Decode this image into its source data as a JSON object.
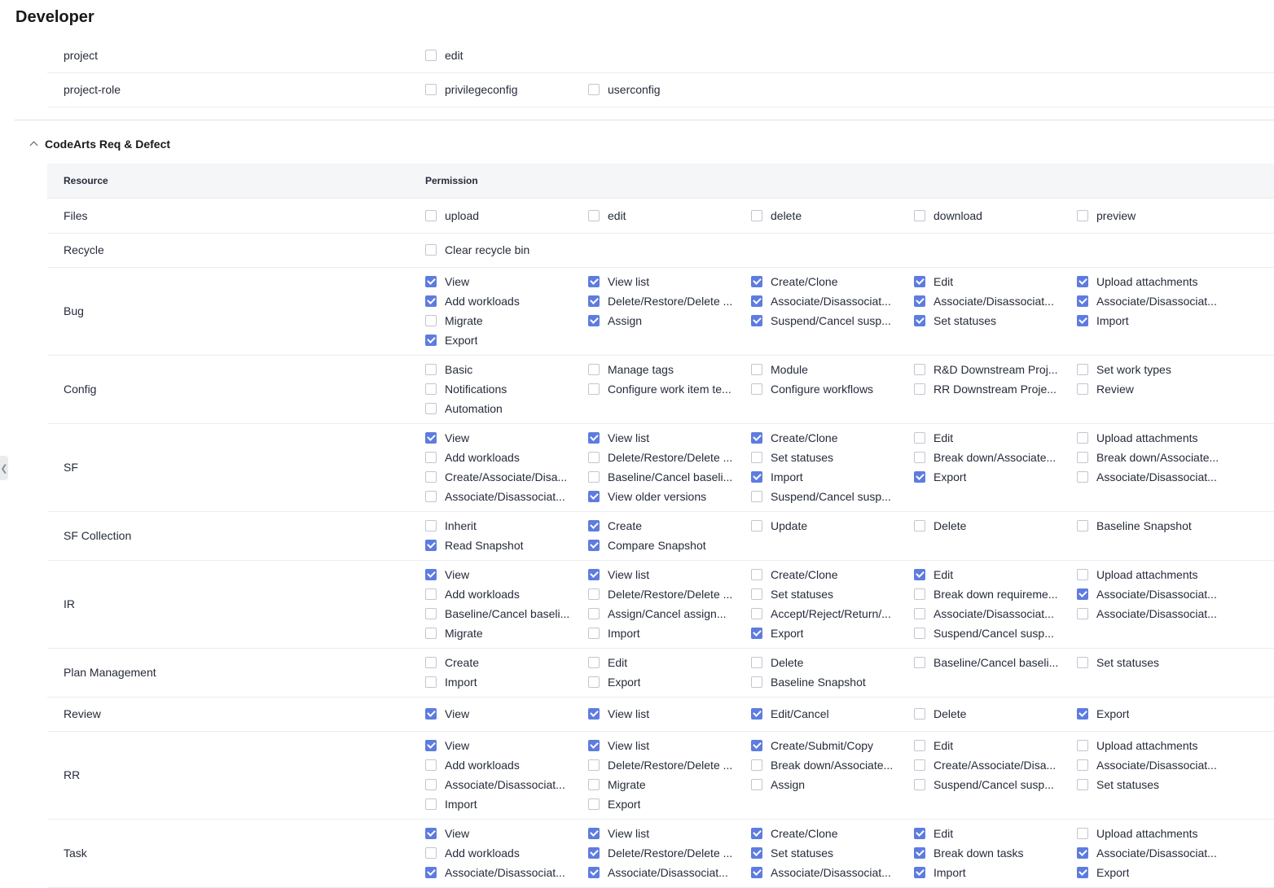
{
  "page": {
    "title": "Developer"
  },
  "section": {
    "title": "CodeArts Req & Defect"
  },
  "table": {
    "col_resource": "Resource",
    "col_permission": "Permission"
  },
  "top_rows": [
    {
      "name": "project",
      "perms": [
        {
          "label": "edit",
          "checked": false
        }
      ]
    },
    {
      "name": "project-role",
      "perms": [
        {
          "label": "privilegeconfig",
          "checked": false
        },
        {
          "label": "userconfig",
          "checked": false
        }
      ]
    }
  ],
  "rows": [
    {
      "name": "Files",
      "perms": [
        {
          "label": "upload",
          "checked": false
        },
        {
          "label": "edit",
          "checked": false
        },
        {
          "label": "delete",
          "checked": false
        },
        {
          "label": "download",
          "checked": false
        },
        {
          "label": "preview",
          "checked": false
        }
      ]
    },
    {
      "name": "Recycle",
      "perms": [
        {
          "label": "Clear recycle bin",
          "checked": false
        }
      ]
    },
    {
      "name": "Bug",
      "perms": [
        {
          "label": "View",
          "checked": true
        },
        {
          "label": "View list",
          "checked": true
        },
        {
          "label": "Create/Clone",
          "checked": true
        },
        {
          "label": "Edit",
          "checked": true
        },
        {
          "label": "Upload attachments",
          "checked": true
        },
        {
          "label": "Add workloads",
          "checked": true
        },
        {
          "label": "Delete/Restore/Delete ...",
          "checked": true
        },
        {
          "label": "Associate/Disassociat...",
          "checked": true
        },
        {
          "label": "Associate/Disassociat...",
          "checked": true
        },
        {
          "label": "Associate/Disassociat...",
          "checked": true
        },
        {
          "label": "Migrate",
          "checked": false
        },
        {
          "label": "Assign",
          "checked": true
        },
        {
          "label": "Suspend/Cancel susp...",
          "checked": true
        },
        {
          "label": "Set statuses",
          "checked": true
        },
        {
          "label": "Import",
          "checked": true
        },
        {
          "label": "Export",
          "checked": true
        }
      ]
    },
    {
      "name": "Config",
      "perms": [
        {
          "label": "Basic",
          "checked": false
        },
        {
          "label": "Manage tags",
          "checked": false
        },
        {
          "label": "Module",
          "checked": false
        },
        {
          "label": "R&D Downstream Proj...",
          "checked": false
        },
        {
          "label": "Set work types",
          "checked": false
        },
        {
          "label": "Notifications",
          "checked": false
        },
        {
          "label": "Configure work item te...",
          "checked": false
        },
        {
          "label": "Configure workflows",
          "checked": false
        },
        {
          "label": "RR Downstream Proje...",
          "checked": false
        },
        {
          "label": "Review",
          "checked": false
        },
        {
          "label": "Automation",
          "checked": false
        }
      ]
    },
    {
      "name": "SF",
      "perms": [
        {
          "label": "View",
          "checked": true
        },
        {
          "label": "View list",
          "checked": true
        },
        {
          "label": "Create/Clone",
          "checked": true
        },
        {
          "label": "Edit",
          "checked": false
        },
        {
          "label": "Upload attachments",
          "checked": false
        },
        {
          "label": "Add workloads",
          "checked": false
        },
        {
          "label": "Delete/Restore/Delete ...",
          "checked": false
        },
        {
          "label": "Set statuses",
          "checked": false
        },
        {
          "label": "Break down/Associate...",
          "checked": false
        },
        {
          "label": "Break down/Associate...",
          "checked": false
        },
        {
          "label": "Create/Associate/Disa...",
          "checked": false
        },
        {
          "label": "Baseline/Cancel baseli...",
          "checked": false
        },
        {
          "label": "Import",
          "checked": true
        },
        {
          "label": "Export",
          "checked": true
        },
        {
          "label": "Associate/Disassociat...",
          "checked": false
        },
        {
          "label": "Associate/Disassociat...",
          "checked": false
        },
        {
          "label": "View older versions",
          "checked": true
        },
        {
          "label": "Suspend/Cancel susp...",
          "checked": false
        }
      ]
    },
    {
      "name": "SF Collection",
      "perms": [
        {
          "label": "Inherit",
          "checked": false
        },
        {
          "label": "Create",
          "checked": true
        },
        {
          "label": "Update",
          "checked": false
        },
        {
          "label": "Delete",
          "checked": false
        },
        {
          "label": "Baseline Snapshot",
          "checked": false
        },
        {
          "label": "Read Snapshot",
          "checked": true
        },
        {
          "label": "Compare Snapshot",
          "checked": true
        }
      ]
    },
    {
      "name": "IR",
      "perms": [
        {
          "label": "View",
          "checked": true
        },
        {
          "label": "View list",
          "checked": true
        },
        {
          "label": "Create/Clone",
          "checked": false
        },
        {
          "label": "Edit",
          "checked": true
        },
        {
          "label": "Upload attachments",
          "checked": false
        },
        {
          "label": "Add workloads",
          "checked": false
        },
        {
          "label": "Delete/Restore/Delete ...",
          "checked": false
        },
        {
          "label": "Set statuses",
          "checked": false
        },
        {
          "label": "Break down requireme...",
          "checked": false
        },
        {
          "label": "Associate/Disassociat...",
          "checked": true
        },
        {
          "label": "Baseline/Cancel baseli...",
          "checked": false
        },
        {
          "label": "Assign/Cancel assign...",
          "checked": false
        },
        {
          "label": "Accept/Reject/Return/...",
          "checked": false
        },
        {
          "label": "Associate/Disassociat...",
          "checked": false
        },
        {
          "label": "Associate/Disassociat...",
          "checked": false
        },
        {
          "label": "Migrate",
          "checked": false
        },
        {
          "label": "Import",
          "checked": false
        },
        {
          "label": "Export",
          "checked": true
        },
        {
          "label": "Suspend/Cancel susp...",
          "checked": false
        }
      ]
    },
    {
      "name": "Plan Management",
      "perms": [
        {
          "label": "Create",
          "checked": false
        },
        {
          "label": "Edit",
          "checked": false
        },
        {
          "label": "Delete",
          "checked": false
        },
        {
          "label": "Baseline/Cancel baseli...",
          "checked": false
        },
        {
          "label": "Set statuses",
          "checked": false
        },
        {
          "label": "Import",
          "checked": false
        },
        {
          "label": "Export",
          "checked": false
        },
        {
          "label": "Baseline Snapshot",
          "checked": false
        }
      ]
    },
    {
      "name": "Review",
      "perms": [
        {
          "label": "View",
          "checked": true
        },
        {
          "label": "View list",
          "checked": true
        },
        {
          "label": "Edit/Cancel",
          "checked": true
        },
        {
          "label": "Delete",
          "checked": false
        },
        {
          "label": "Export",
          "checked": true
        }
      ]
    },
    {
      "name": "RR",
      "perms": [
        {
          "label": "View",
          "checked": true
        },
        {
          "label": "View list",
          "checked": true
        },
        {
          "label": "Create/Submit/Copy",
          "checked": true
        },
        {
          "label": "Edit",
          "checked": false
        },
        {
          "label": "Upload attachments",
          "checked": false
        },
        {
          "label": "Add workloads",
          "checked": false
        },
        {
          "label": "Delete/Restore/Delete ...",
          "checked": false
        },
        {
          "label": "Break down/Associate...",
          "checked": false
        },
        {
          "label": "Create/Associate/Disa...",
          "checked": false
        },
        {
          "label": "Associate/Disassociat...",
          "checked": false
        },
        {
          "label": "Associate/Disassociat...",
          "checked": false
        },
        {
          "label": "Migrate",
          "checked": false
        },
        {
          "label": "Assign",
          "checked": false
        },
        {
          "label": "Suspend/Cancel susp...",
          "checked": false
        },
        {
          "label": "Set statuses",
          "checked": false
        },
        {
          "label": "Import",
          "checked": false
        },
        {
          "label": "Export",
          "checked": false
        }
      ]
    },
    {
      "name": "Task",
      "perms": [
        {
          "label": "View",
          "checked": true
        },
        {
          "label": "View list",
          "checked": true
        },
        {
          "label": "Create/Clone",
          "checked": true
        },
        {
          "label": "Edit",
          "checked": true
        },
        {
          "label": "Upload attachments",
          "checked": false
        },
        {
          "label": "Add workloads",
          "checked": false
        },
        {
          "label": "Delete/Restore/Delete ...",
          "checked": true
        },
        {
          "label": "Set statuses",
          "checked": true
        },
        {
          "label": "Break down tasks",
          "checked": true
        },
        {
          "label": "Associate/Disassociat...",
          "checked": true
        },
        {
          "label": "Associate/Disassociat...",
          "checked": true
        },
        {
          "label": "Associate/Disassociat...",
          "checked": true
        },
        {
          "label": "Associate/Disassociat...",
          "checked": true
        },
        {
          "label": "Import",
          "checked": true
        },
        {
          "label": "Export",
          "checked": true
        }
      ]
    }
  ],
  "colors": {
    "accent": "#5e7ce0",
    "border": "#ebecf0",
    "header_bg": "#f5f6f8"
  }
}
